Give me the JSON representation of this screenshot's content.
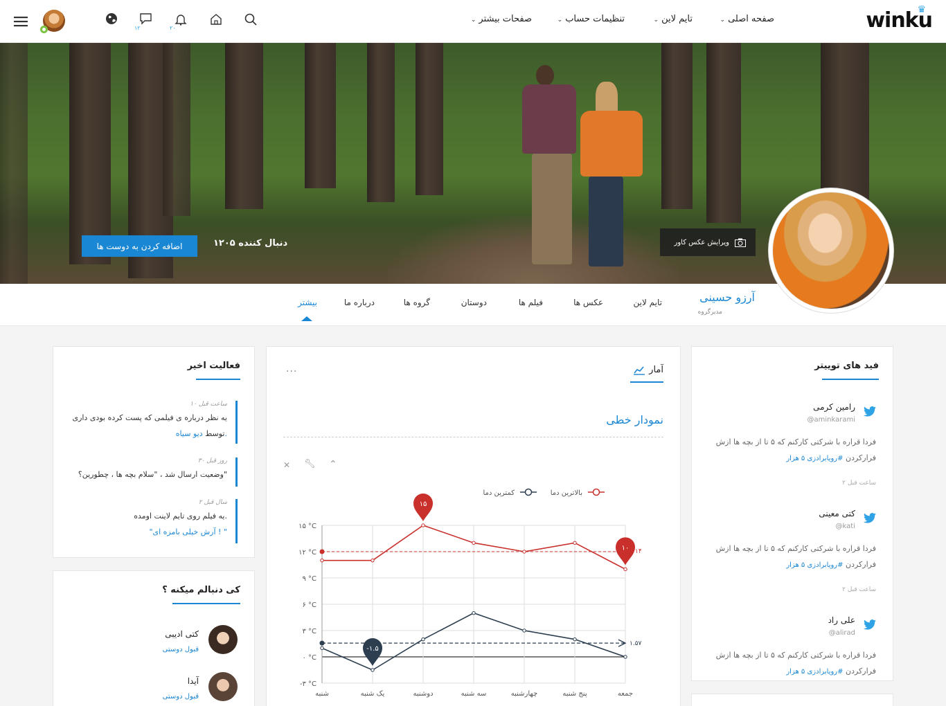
{
  "header": {
    "logo": "winku",
    "menu": [
      {
        "label": "صفحه اصلی"
      },
      {
        "label": "تایم لاین"
      },
      {
        "label": "تنظیمات حساب"
      },
      {
        "label": "صفحات بیشتر"
      }
    ],
    "messages_badge": "۱۲",
    "notifications_badge": "۲۰"
  },
  "cover": {
    "edit_label": "ویرایش عکس کاور",
    "followers": "۱۲۰۵ دنبال کننده",
    "add_friend": "اضافه کردن به دوست ها"
  },
  "profile": {
    "name": "آرزو حسینی",
    "role": "مدیرگروه",
    "tabs": [
      "تایم لاین",
      "عکس ها",
      "فیلم ها",
      "دوستان",
      "گروه ها",
      "درباره ما",
      "بیشتر"
    ],
    "active_tab": "بیشتر"
  },
  "recent_activity": {
    "title": "فعالیت اخیر",
    "items": [
      {
        "time": "۱۰ ساعت قبل",
        "text": "یه نظر درباره ی فیلمی که پست کرده بودی داری",
        "by": "توسط",
        "by_link": "دیو سیاه."
      },
      {
        "time": "۳۰ روز قبل",
        "text": "وضعیت ارسال شد ، \"سلام بچه ها ، چطورین؟\""
      },
      {
        "time": "۲ سال قبل",
        "text": "یه فیلم روی تایم لاینت اومده.",
        "link": "\"آرش خیلی بامزه ای ! \""
      }
    ]
  },
  "who_follows": {
    "title": "کی دنبالم میکنه ؟",
    "items": [
      {
        "name": "کتی ادیبی",
        "action": "قبول دوستی"
      },
      {
        "name": "آیدا",
        "action": "قبول دوستی"
      }
    ]
  },
  "stats": {
    "title": "آمار",
    "subtitle": "نمودار خطی",
    "more": "..."
  },
  "chart_data": {
    "type": "line",
    "categories": [
      "شنبه",
      "یک شنبه",
      "دوشنبه",
      "سه شنبه",
      "چهارشنبه",
      "پنج شنبه",
      "جمعه"
    ],
    "series": [
      {
        "name": "بالاترین دما",
        "color": "#c9302c",
        "values": [
          11,
          11,
          15,
          13,
          12,
          13,
          10
        ]
      },
      {
        "name": "کمترین دما",
        "color": "#2c3e50",
        "values": [
          1,
          -1.5,
          2,
          5,
          3,
          2,
          0
        ]
      }
    ],
    "yticks": [
      "-۳ °C",
      "۰ °C",
      "۳ °C",
      "۶ °C",
      "۹ °C",
      "۱۲ °C",
      "۱۵ °C"
    ],
    "ytick_values": [
      -3,
      0,
      3,
      6,
      9,
      12,
      15
    ],
    "ylim": [
      -3,
      15
    ],
    "max_marker": "۱۵",
    "min_marker": "-۱.۵",
    "last_marker": "۱۰",
    "avg_high": 12,
    "avg_high_label": "۱۴",
    "avg_low": 1.57,
    "avg_low_label": "۱.۵۷",
    "grid": true,
    "legend_position": "top"
  },
  "twitter": {
    "title": "فید های توییتر",
    "tweets": [
      {
        "name": "رامین کرمی",
        "handle": "@aminkarami",
        "text": "فردا قراره با شرکتی کارکنم که ۵ تا از بچه ها ازش",
        "text2": "فرارکردن",
        "tag": "#رویابرادزی ۵ هزار",
        "ago": "۲ ساعت قبل"
      },
      {
        "name": "کتی معینی",
        "handle": "@kati",
        "text": "فردا قراره با شرکتی کارکنم که ۵ تا از بچه ها ازش",
        "text2": "فرارکردن",
        "tag": "#رویابرادزی ۵ هزار",
        "ago": "۲ ساعت قبل"
      },
      {
        "name": "علی راد",
        "handle": "@alirad",
        "text": "فردا قراره با شرکتی کارکنم که ۵ تا از بچه ها ازش",
        "text2": "فرارکردن",
        "tag": "#رویابرادزی ۵ هزار"
      }
    ]
  },
  "colors": {
    "accent": "#1a87d4",
    "twitter": "#2fa3e6",
    "red": "#c9302c",
    "dark": "#2c3e50"
  }
}
